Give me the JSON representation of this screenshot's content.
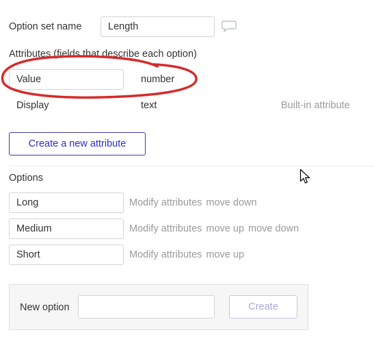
{
  "header": {
    "option_set_label": "Option set name",
    "option_set_value": "Length",
    "comment_icon": "speech-bubble-icon"
  },
  "attributes": {
    "heading": "Attributes (fields that describe each option)",
    "rows": [
      {
        "name": "Value",
        "type": "number",
        "note": ""
      },
      {
        "name": "Display",
        "type": "text",
        "note": "Built-in attribute"
      }
    ],
    "create_button": "Create a new attribute"
  },
  "options": {
    "heading": "Options",
    "items": [
      {
        "value": "Long",
        "actions": [
          "Modify attributes",
          "move down"
        ]
      },
      {
        "value": "Medium",
        "actions": [
          "Modify attributes",
          "move up",
          "move down"
        ]
      },
      {
        "value": "Short",
        "actions": [
          "Modify attributes",
          "move up"
        ]
      }
    ]
  },
  "new_option": {
    "label": "New option",
    "input_value": "",
    "create_button": "Create"
  },
  "colors": {
    "annotation_red": "#d62b2b",
    "primary_blue": "#2b2bd1"
  }
}
